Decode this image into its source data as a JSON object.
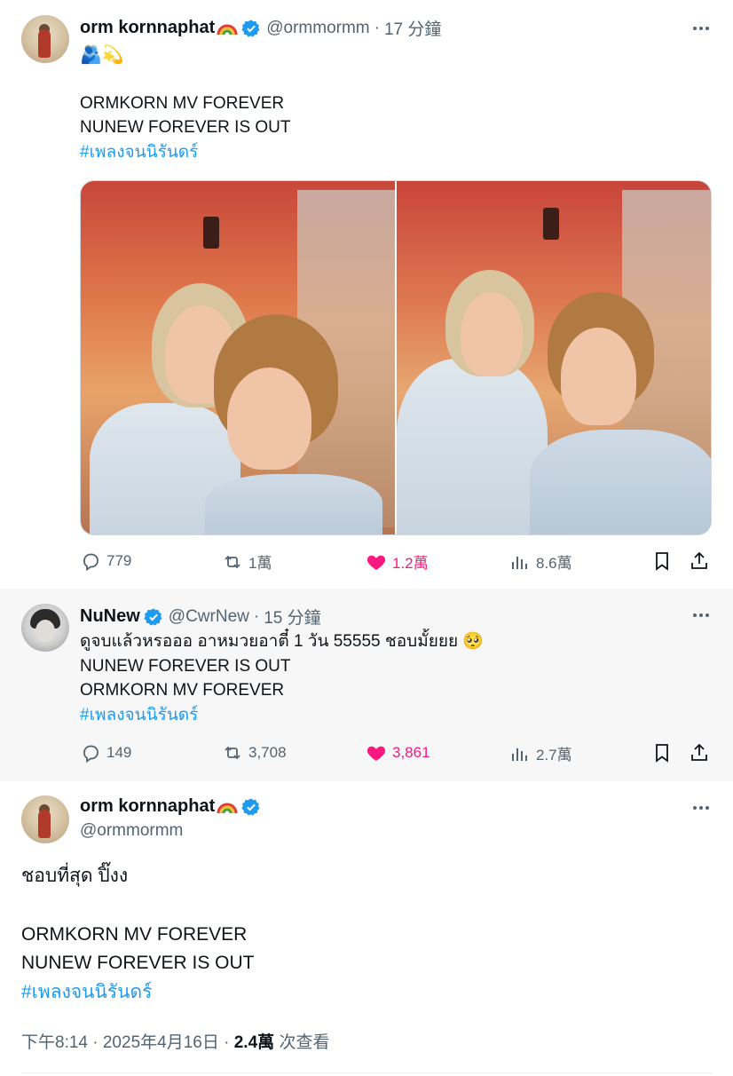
{
  "tweet1": {
    "author_name": "orm kornnaphat",
    "author_emoji": "🌈",
    "handle": "@ormmormm",
    "time": "17 分鐘",
    "emoji_line": "🫂💫",
    "line1": "ORMKORN MV FOREVER",
    "line2": "NUNEW FOREVER IS OUT",
    "hashtag": "#เพลงจนนิรันดร์",
    "replies": "779",
    "reposts": "1萬",
    "likes": "1.2萬",
    "views": "8.6萬"
  },
  "tweet2": {
    "author_name": "NuNew",
    "handle": "@CwrNew",
    "time": "15 分鐘",
    "line1": "ดูจบแล้วหรอออ อาหมวยอาตี๋ 1 วัน 55555 ชอบมั้ยยย 🥺",
    "line2": "NUNEW FOREVER IS OUT",
    "line3": "ORMKORN MV FOREVER",
    "hashtag": "#เพลงจนนิรันดร์",
    "replies": "149",
    "reposts": "3,708",
    "likes": "3,861",
    "views": "2.7萬"
  },
  "tweet3": {
    "author_name": "orm kornnaphat",
    "author_emoji": "🌈",
    "handle": "@ormmormm",
    "line1": "ชอบที่สุด ปิ๊งง",
    "line2": "ORMKORN MV FOREVER",
    "line3": "NUNEW FOREVER IS OUT",
    "hashtag": "#เพลงจนนิรันดร์",
    "timestamp": "下午8:14 · 2025年4月16日",
    "views_count": "2.4萬",
    "views_label": "次查看"
  },
  "colors": {
    "verified": "#1d9bf0",
    "hashtag": "#1d9bf0",
    "like_active": "#f91880",
    "muted": "#536471"
  }
}
